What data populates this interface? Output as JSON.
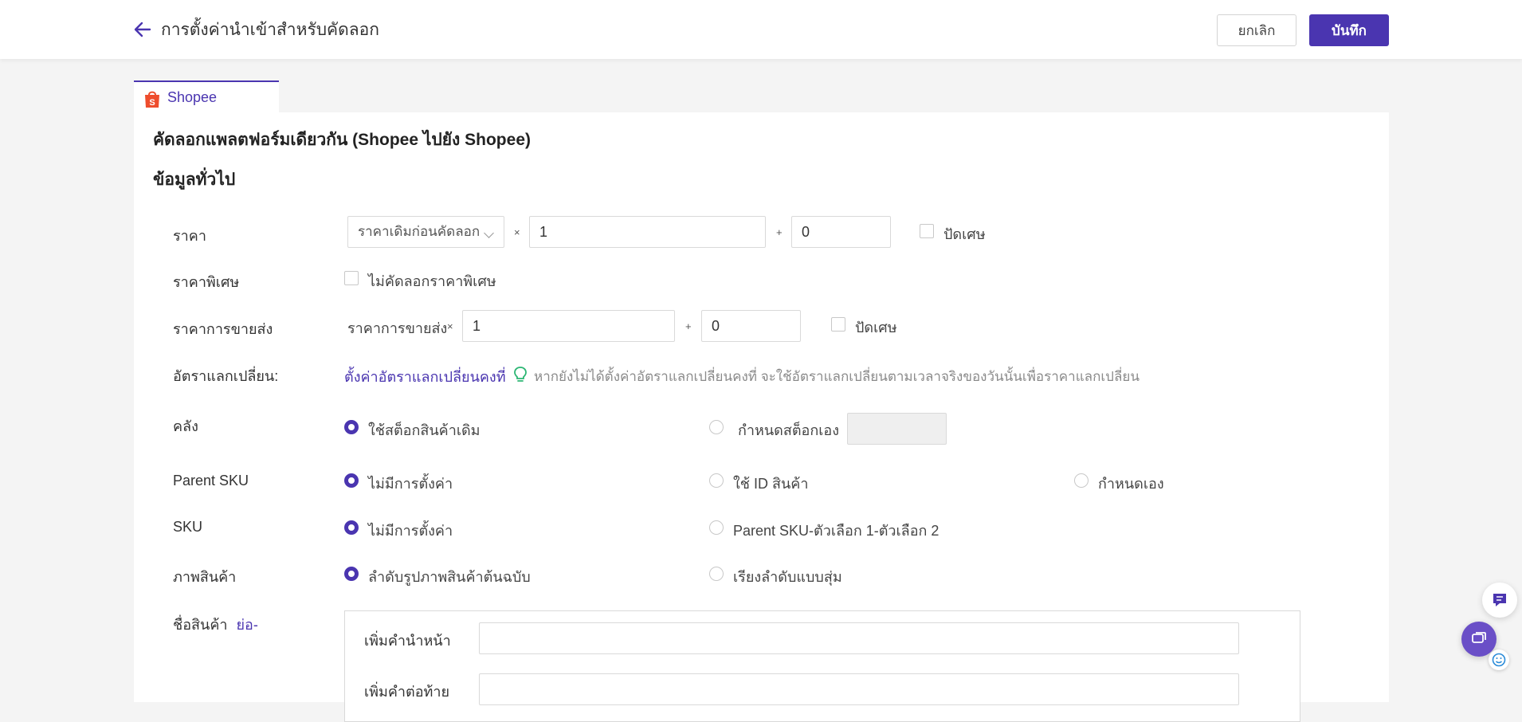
{
  "header": {
    "title": "การตั้งค่านำเข้าสำหรับคัดลอก",
    "cancel_label": "ยกเลิก",
    "save_label": "บันทึก",
    "accent_color": "#4a35b0"
  },
  "tabs": [
    {
      "label": "Shopee",
      "icon": "shopee-bag-icon",
      "active": true
    }
  ],
  "section": {
    "title": "คัดลอกแพลตฟอร์มเดียวกัน (Shopee ไปยัง Shopee)",
    "subtitle": "ข้อมูลทั่วไป"
  },
  "price": {
    "label": "ราคา",
    "source_select": "ราคาเดิมก่อนคัดลอก",
    "multiply_symbol": "×",
    "multiplier": "1",
    "plus_symbol": "+",
    "addend": "0",
    "round_label": "ปัดเศษ",
    "round_checked": false
  },
  "special_price": {
    "label": "ราคาพิเศษ",
    "option_label": "ไม่คัดลอกราคาพิเศษ",
    "checked": false
  },
  "wholesale": {
    "label": "ราคาการขายส่ง",
    "prefix": "ราคาการขายส่ง",
    "multiply_symbol": "×",
    "multiplier": "1",
    "plus_symbol": "+",
    "addend": "0",
    "round_label": "ปัดเศษ",
    "round_checked": false
  },
  "exchange_rate": {
    "label": "อัตราแลกเปลี่ยน:",
    "link": "ตั้งค่าอัตราแลกเปลี่ยนคงที่",
    "hint": "หากยังไม่ได้ตั้งค่าอัตราแลกเปลี่ยนคงที่ จะใช้อัตราแลกเปลี่ยนตามเวลาจริงของวันนั้นเพื่อราคาแลกเปลี่ยน"
  },
  "stock": {
    "label": "คลัง",
    "options": [
      "ใช้สต็อกสินค้าเดิม",
      "กำหนดสต็อกเอง"
    ],
    "selected": 0,
    "custom_value": ""
  },
  "parent_sku": {
    "label": "Parent SKU",
    "options": [
      "ไม่มีการตั้งค่า",
      "ใช้ ID สินค้า",
      "กำหนดเอง"
    ],
    "selected": 0
  },
  "sku": {
    "label": "SKU",
    "options": [
      "ไม่มีการตั้งค่า",
      "Parent SKU-ตัวเลือก 1-ตัวเลือก 2"
    ],
    "selected": 0
  },
  "images": {
    "label": "ภาพสินค้า",
    "options": [
      "ลำดับรูปภาพสินค้าต้นฉบับ",
      "เรียงลำดับแบบสุ่ม"
    ],
    "selected": 0
  },
  "product_name": {
    "label": "ชื่อสินค้า",
    "toggle": "ย่อ-",
    "prefix_label": "เพิ่มคำนำหน้า",
    "prefix_value": "",
    "suffix_label": "เพิ่มคำต่อท้าย",
    "suffix_value": ""
  }
}
